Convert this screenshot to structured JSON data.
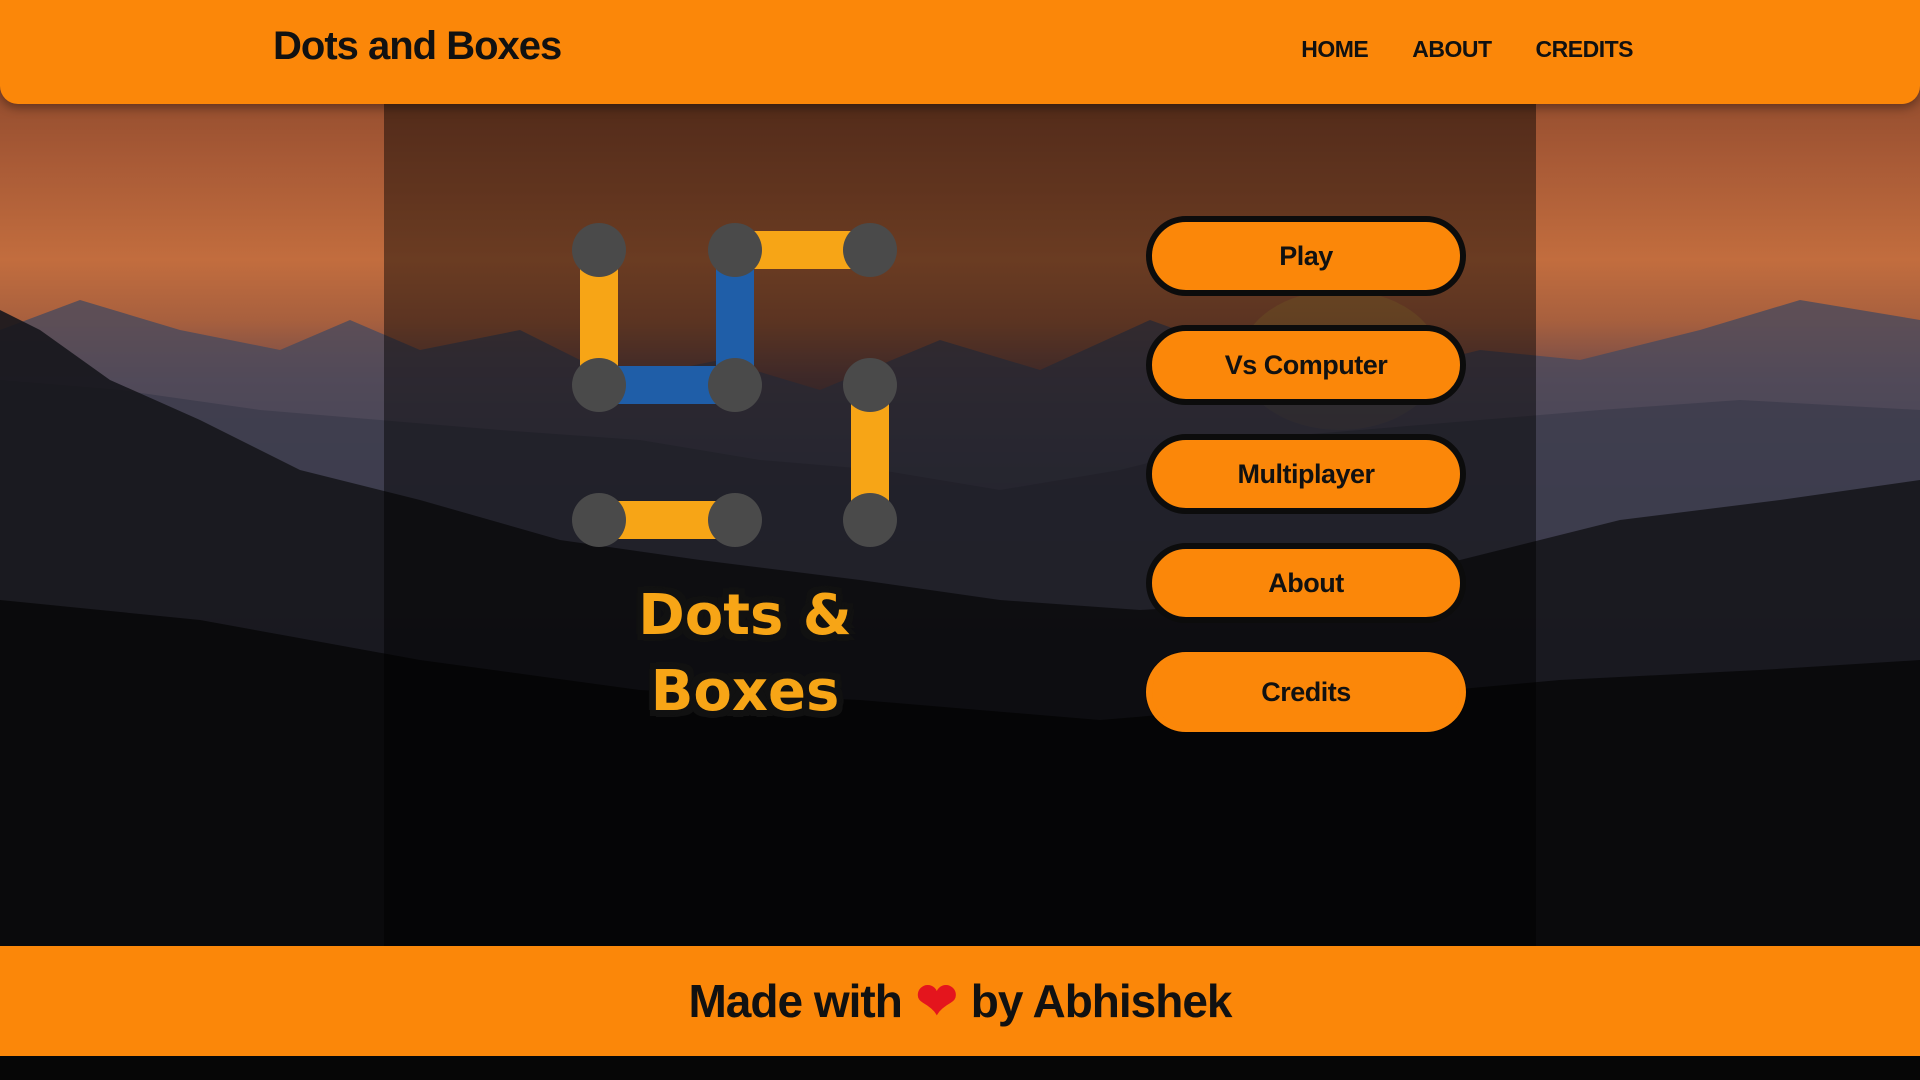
{
  "header": {
    "brand": "Dots and Boxes",
    "nav": [
      "HOME",
      "ABOUT",
      "CREDITS"
    ]
  },
  "logo": {
    "title_line1": "Dots &",
    "title_line2": "Boxes",
    "colors": {
      "dot": "#4a4a4a",
      "line_yellow": "#f7a516",
      "line_blue": "#1f5ea8"
    }
  },
  "menu": {
    "buttons": [
      "Play",
      "Vs Computer",
      "Multiplayer",
      "About",
      "Credits"
    ]
  },
  "footer": {
    "text_before": "Made with",
    "heart_icon": "heart-icon",
    "text_after": "by Abhishek"
  },
  "colors": {
    "accent": "#fb8709",
    "text": "#111111"
  }
}
